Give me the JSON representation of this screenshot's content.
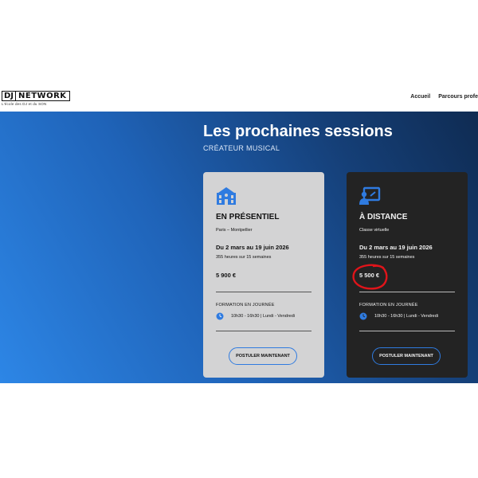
{
  "header": {
    "logo": {
      "dj": "DJ",
      "network": "NETWORK",
      "tagline": "L'école des DJ et du SON"
    },
    "nav": [
      "Accueil",
      "Parcours profe"
    ]
  },
  "hero": {
    "title": "Les prochaines sessions",
    "subtitle": "CRÉATEUR MUSICAL"
  },
  "cards": [
    {
      "icon": "building-icon",
      "title": "EN PRÉSENTIEL",
      "location": "Paris – Montpellier",
      "dates": "Du 2 mars au 19 juin 2026",
      "hours": "355 heures sur 15 semaines",
      "price": "5 900 €",
      "format": "FORMATION EN JOURNÉE",
      "schedule": "10h30 - 16h30 | Lundi - Vendredi",
      "cta": "POSTULER MAINTENANT"
    },
    {
      "icon": "virtual-classroom-icon",
      "title": "À DISTANCE",
      "location": "Classe virtuelle",
      "dates": "Du 2 mars au 19 juin 2026",
      "hours": "355 heures sur 15 semaines",
      "price": "5 500 €",
      "format": "FORMATION EN JOURNÉE",
      "schedule": "10h30 - 16h30 | Lundi - Vendredi",
      "cta": "POSTULER MAINTENANT"
    }
  ],
  "colors": {
    "accent": "#2f7be0",
    "card_light": "#d3d3d4",
    "card_dark": "#232323",
    "annotation": "#e0141a"
  }
}
